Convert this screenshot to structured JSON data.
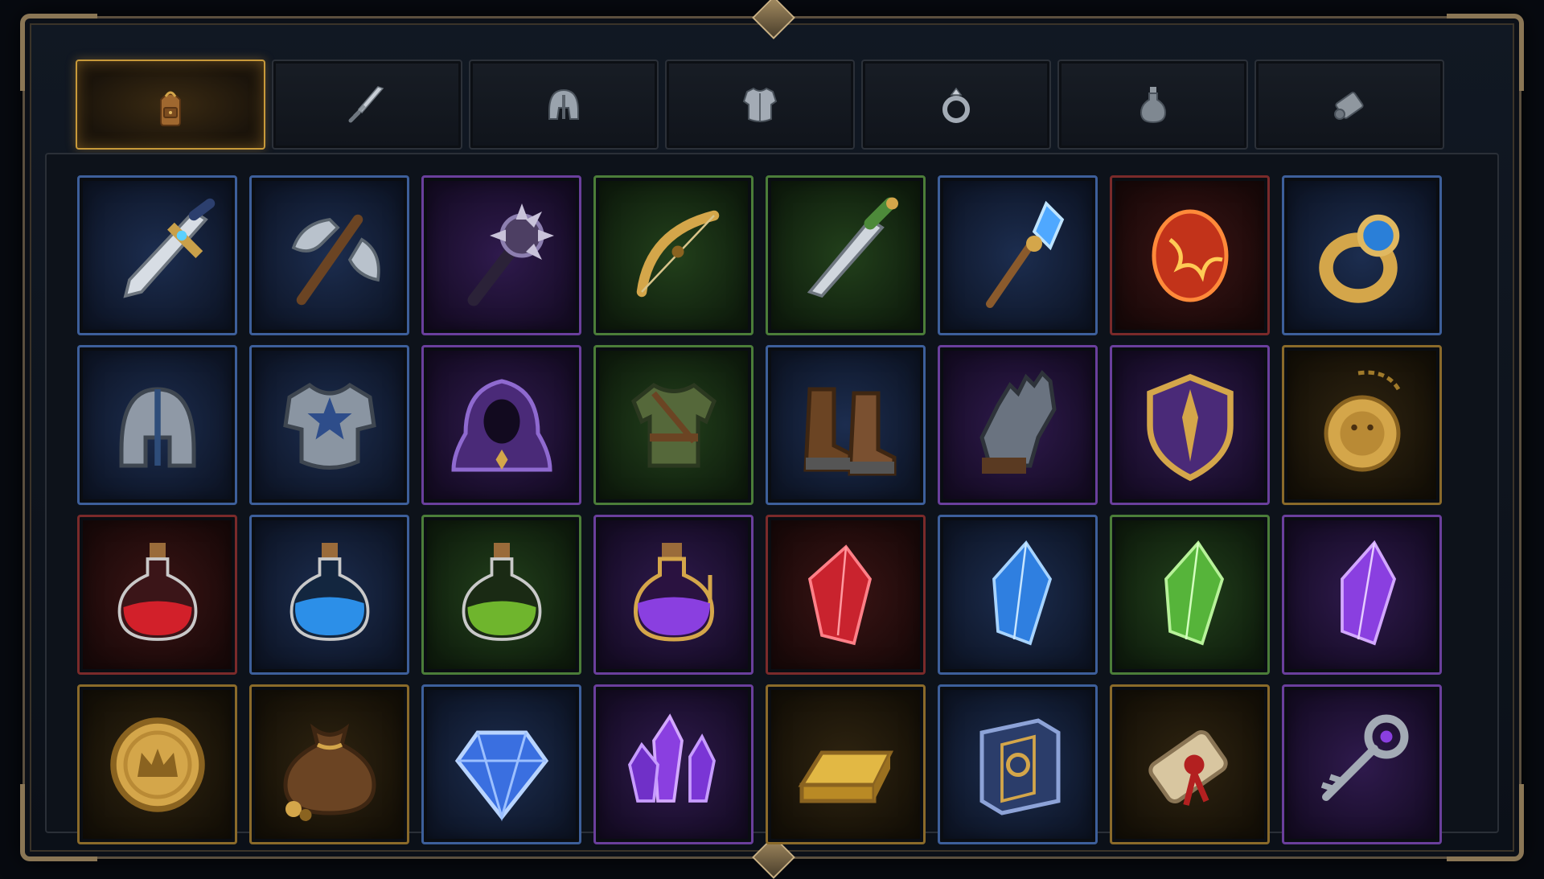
{
  "window": {
    "accent_color": "#c89a3a"
  },
  "tabs": [
    {
      "id": "bag",
      "icon": "backpack-icon",
      "active": true
    },
    {
      "id": "weapons",
      "icon": "sword-icon",
      "active": false
    },
    {
      "id": "helmets",
      "icon": "helmet-icon",
      "active": false
    },
    {
      "id": "armor",
      "icon": "chest-armor-icon",
      "active": false
    },
    {
      "id": "rings",
      "icon": "ring-icon",
      "active": false
    },
    {
      "id": "potions",
      "icon": "potion-icon",
      "active": false
    },
    {
      "id": "scrolls",
      "icon": "scroll-icon",
      "active": false
    }
  ],
  "rarity_colors": {
    "blue": "#3d5f9a",
    "purple": "#6a3f9c",
    "green": "#4b7d39",
    "red": "#7a2a2a",
    "gold": "#8a6a2a"
  },
  "inventory": [
    [
      {
        "icon": "dagger-icon",
        "rarity": "blue"
      },
      {
        "icon": "battle-axe-icon",
        "rarity": "blue"
      },
      {
        "icon": "spiked-mace-icon",
        "rarity": "purple"
      },
      {
        "icon": "bow-icon",
        "rarity": "green"
      },
      {
        "icon": "green-dagger-icon",
        "rarity": "green"
      },
      {
        "icon": "crystal-staff-icon",
        "rarity": "blue"
      },
      {
        "icon": "fire-gem-icon",
        "rarity": "red"
      },
      {
        "icon": "sapphire-ring-icon",
        "rarity": "blue"
      }
    ],
    [
      {
        "icon": "knight-helmet-icon",
        "rarity": "blue"
      },
      {
        "icon": "plate-armor-icon",
        "rarity": "blue"
      },
      {
        "icon": "hooded-cloak-icon",
        "rarity": "purple"
      },
      {
        "icon": "leather-tunic-icon",
        "rarity": "green"
      },
      {
        "icon": "boots-icon",
        "rarity": "blue"
      },
      {
        "icon": "gauntlet-icon",
        "rarity": "purple"
      },
      {
        "icon": "shield-icon",
        "rarity": "purple"
      },
      {
        "icon": "lion-amulet-icon",
        "rarity": "gold"
      }
    ],
    [
      {
        "icon": "health-potion-icon",
        "rarity": "red"
      },
      {
        "icon": "mana-potion-icon",
        "rarity": "blue"
      },
      {
        "icon": "stamina-potion-icon",
        "rarity": "green"
      },
      {
        "icon": "purple-elixir-icon",
        "rarity": "purple"
      },
      {
        "icon": "ruby-crystal-icon",
        "rarity": "red"
      },
      {
        "icon": "sapphire-crystal-icon",
        "rarity": "blue"
      },
      {
        "icon": "emerald-crystal-icon",
        "rarity": "green"
      },
      {
        "icon": "amethyst-crystal-icon",
        "rarity": "purple"
      }
    ],
    [
      {
        "icon": "gold-coin-icon",
        "rarity": "gold"
      },
      {
        "icon": "coin-pouch-icon",
        "rarity": "gold"
      },
      {
        "icon": "diamond-icon",
        "rarity": "blue"
      },
      {
        "icon": "crystal-cluster-icon",
        "rarity": "purple"
      },
      {
        "icon": "gold-bar-icon",
        "rarity": "gold"
      },
      {
        "icon": "spellbook-icon",
        "rarity": "blue"
      },
      {
        "icon": "sealed-scroll-icon",
        "rarity": "gold"
      },
      {
        "icon": "ornate-key-icon",
        "rarity": "purple"
      }
    ]
  ]
}
